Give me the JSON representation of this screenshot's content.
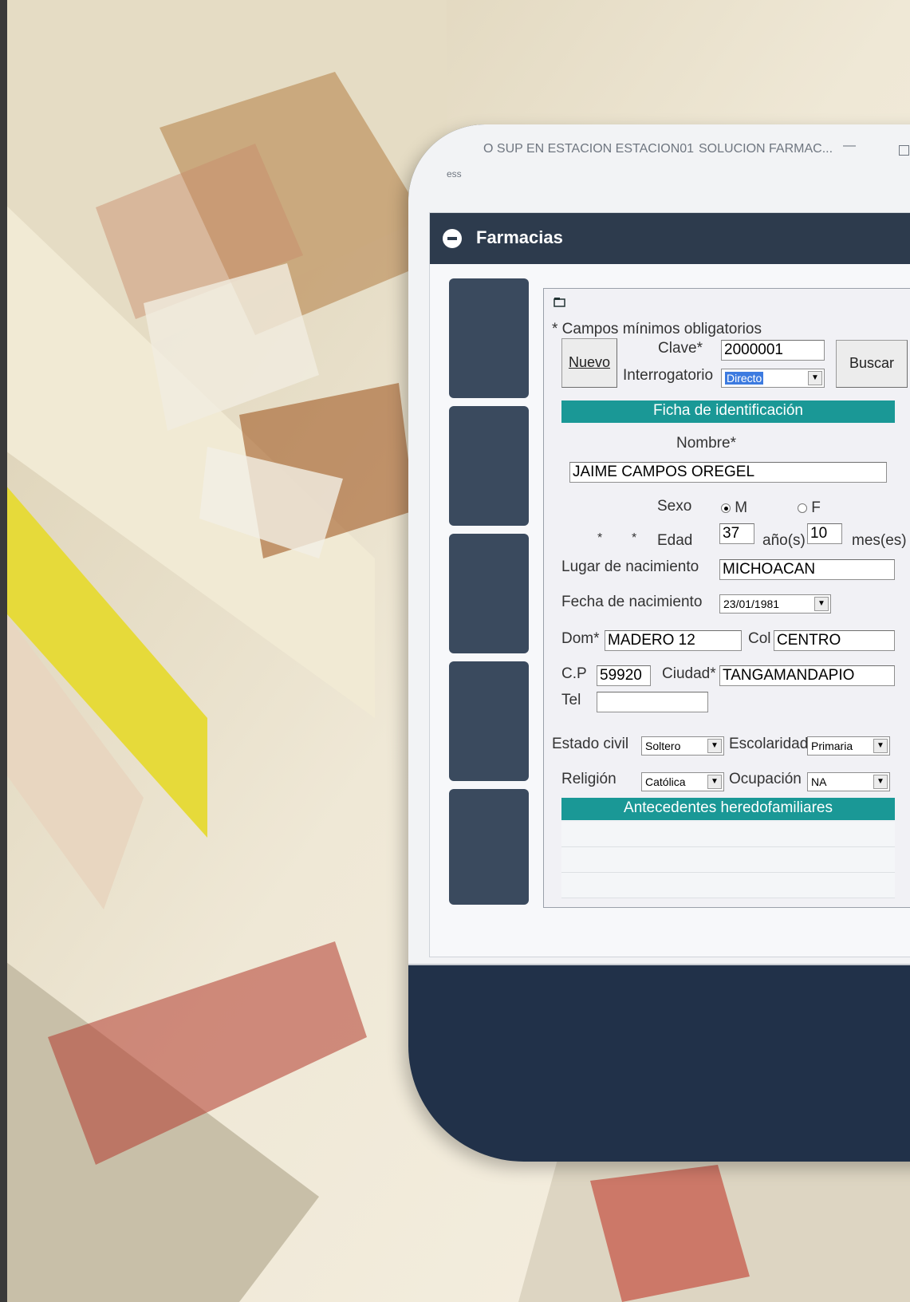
{
  "window": {
    "title_left": "O SUP EN ESTACION ESTACION01",
    "title_right": "SOLUCION FARMAC...",
    "minimize_glyph": "—",
    "menu_fragment": "ess"
  },
  "panel": {
    "title": "Farmacias"
  },
  "form": {
    "required_note": "* Campos mínimos obligatorios",
    "clave_label": "Clave*",
    "clave_value": "2000001",
    "new_button": "Nuevo",
    "interrogatorio_label": "Interrogatorio",
    "interrogatorio_value": "Directo",
    "search_button": "Buscar",
    "section_identificacion": "Ficha de identificación",
    "nombre_label": "Nombre*",
    "nombre_value": "JAIME CAMPOS OREGEL",
    "sexo_label": "Sexo",
    "sexo_m": "M",
    "sexo_f": "F",
    "sexo_selected": "M",
    "edad_star1": "*",
    "edad_star2": "*",
    "edad_label": "Edad",
    "edad_years": "37",
    "edad_years_unit": "año(s)",
    "edad_months": "10",
    "edad_months_unit": "mes(es)",
    "lugar_label": "Lugar de nacimiento",
    "lugar_value": "MICHOACAN",
    "fecha_label": "Fecha de nacimiento",
    "fecha_value": "23/01/1981",
    "dom_label": "Dom*",
    "dom_value": "MADERO 12",
    "col_label": "Col",
    "col_value": "CENTRO",
    "cp_label": "C.P",
    "cp_value": "59920",
    "ciudad_label": "Ciudad*",
    "ciudad_value": "TANGAMANDAPIO",
    "tel_label": "Tel",
    "tel_value": "",
    "estado_civil_label": "Estado civil",
    "estado_civil_value": "Soltero",
    "escolaridad_label": "Escolaridad",
    "escolaridad_value": "Primaria",
    "religion_label": "Religión",
    "religion_value": "Católica",
    "ocupacion_label": "Ocupación",
    "ocupacion_value": "NA",
    "section_antecedentes": "Antecedentes heredofamiliares"
  },
  "colors": {
    "card_navy": "#213149",
    "panel_header": "#2d3b4d",
    "section_teal": "#1a9896",
    "highlight_blue": "#3d7be0"
  },
  "icons": {
    "collapse": "minus-circle-icon",
    "dialog": "form-icon",
    "dropdown": "chevron-down-icon"
  }
}
